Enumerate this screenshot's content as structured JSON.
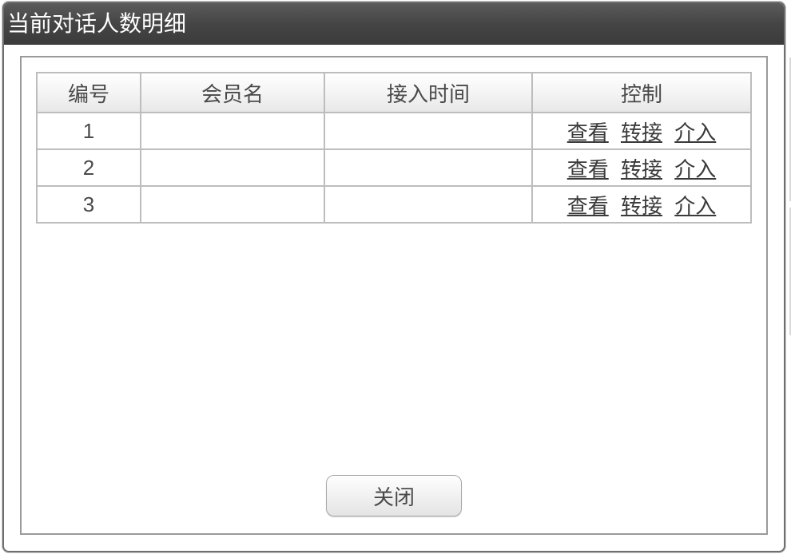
{
  "dialog": {
    "title": "当前对话人数明细",
    "close_label": "关闭"
  },
  "table": {
    "headers": {
      "number": "编号",
      "member_name": "会员名",
      "access_time": "接入时间",
      "control": "控制"
    },
    "rows": [
      {
        "number": "1",
        "member_name": "",
        "access_time": ""
      },
      {
        "number": "2",
        "member_name": "",
        "access_time": ""
      },
      {
        "number": "3",
        "member_name": "",
        "access_time": ""
      }
    ],
    "actions": {
      "view": "查看",
      "transfer": "转接",
      "intervene": "介入"
    }
  }
}
